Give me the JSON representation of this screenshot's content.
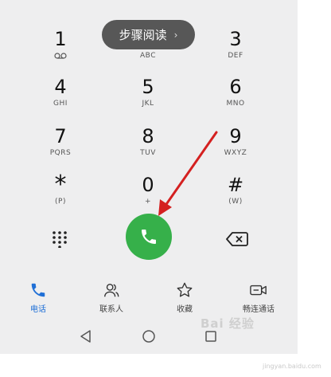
{
  "toast": {
    "label": "步骤阅读",
    "chevron": "›"
  },
  "keypad": [
    {
      "digit": "1",
      "sub": "",
      "icon": "voicemail-icon"
    },
    {
      "digit": "2",
      "sub": "ABC"
    },
    {
      "digit": "3",
      "sub": "DEF"
    },
    {
      "digit": "4",
      "sub": "GHI"
    },
    {
      "digit": "5",
      "sub": "JKL"
    },
    {
      "digit": "6",
      "sub": "MNO"
    },
    {
      "digit": "7",
      "sub": "PQRS"
    },
    {
      "digit": "8",
      "sub": "TUV"
    },
    {
      "digit": "9",
      "sub": "WXYZ"
    },
    {
      "digit": "*",
      "sub": "(P)"
    },
    {
      "digit": "0",
      "sub": "+"
    },
    {
      "digit": "#",
      "sub": "(W)"
    }
  ],
  "actions": {
    "dialpad_icon": "dialpad-icon",
    "call_icon": "phone-icon",
    "backspace_icon": "backspace-icon",
    "call_color": "#36b04a"
  },
  "tabs": [
    {
      "label": "电话",
      "icon": "phone-icon",
      "active": true
    },
    {
      "label": "联系人",
      "icon": "contacts-icon",
      "active": false
    },
    {
      "label": "收藏",
      "icon": "star-icon",
      "active": false
    },
    {
      "label": "畅连通话",
      "icon": "video-call-icon",
      "active": false
    }
  ],
  "navbar": [
    "back-icon",
    "home-icon",
    "recents-icon"
  ],
  "watermark": {
    "text": "Bai 经验",
    "url": "jingyan.baidu.com"
  },
  "colors": {
    "accent": "#1f6fd6",
    "arrow": "#d42020",
    "background": "#eeeeef"
  }
}
